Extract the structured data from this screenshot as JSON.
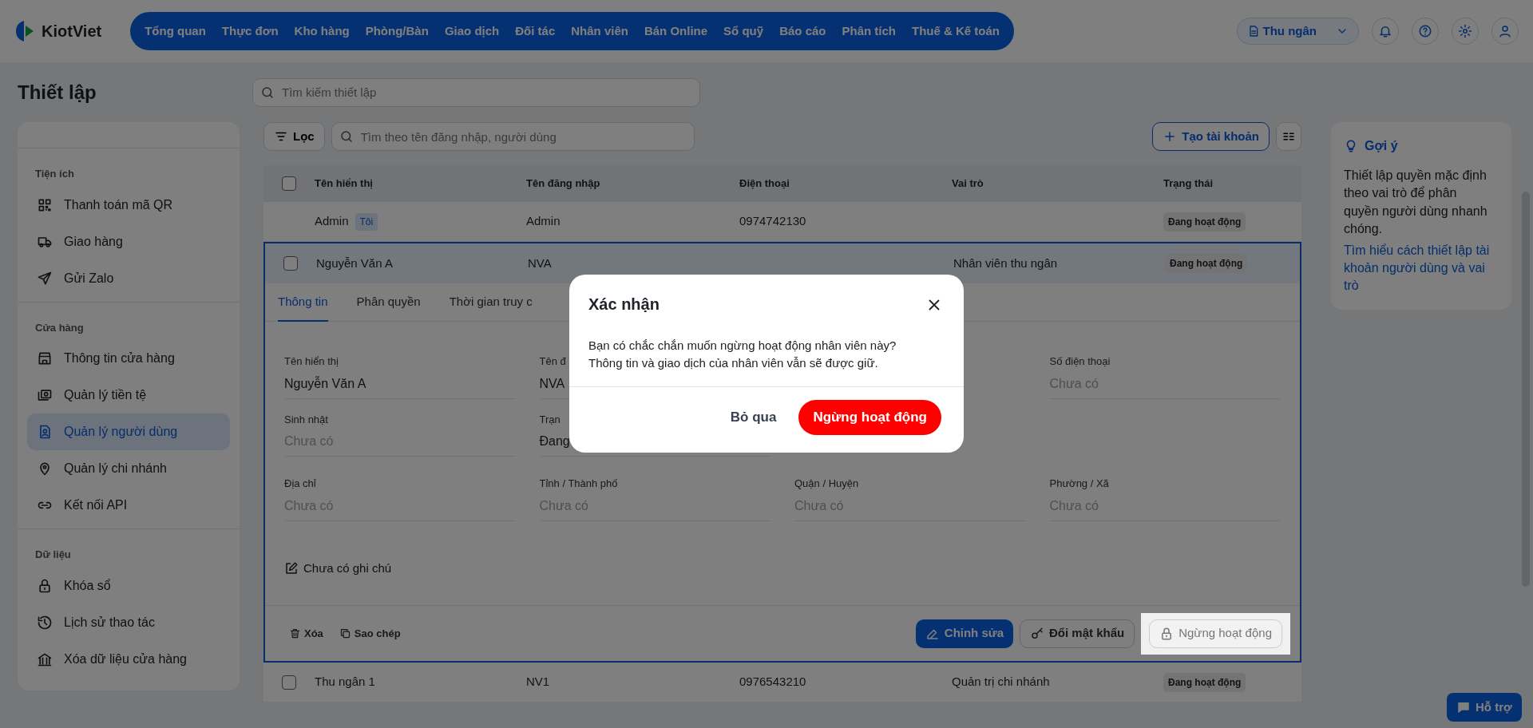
{
  "header": {
    "logo": "KiotViet",
    "nav": [
      {
        "label": "Tổng quan"
      },
      {
        "label": "Thực đơn"
      },
      {
        "label": "Kho hàng"
      },
      {
        "label": "Phòng/Bàn"
      },
      {
        "label": "Giao dịch"
      },
      {
        "label": "Đối tác"
      },
      {
        "label": "Nhân viên"
      },
      {
        "label": "Bán Online"
      },
      {
        "label": "Sổ quỹ"
      },
      {
        "label": "Báo cáo"
      },
      {
        "label": "Phân tích"
      },
      {
        "label": "Thuế & Kế toán"
      }
    ],
    "role_button": "Thu ngân"
  },
  "page": {
    "title": "Thiết lập",
    "search": {
      "placeholder": "Tìm kiếm thiết lập"
    }
  },
  "sidebar": {
    "groups": [
      {
        "title": "Tiện ích",
        "items": [
          {
            "kind": "qr",
            "label": "Thanh toán mã QR",
            "selected": false
          },
          {
            "kind": "truck",
            "label": "Giao hàng",
            "selected": false
          },
          {
            "kind": "send",
            "label": "Gửi Zalo",
            "selected": false
          }
        ]
      },
      {
        "title": "Cửa hàng",
        "items": [
          {
            "kind": "store",
            "label": "Thông tin cửa hàng",
            "selected": false
          },
          {
            "kind": "money",
            "label": "Quản lý tiền tệ",
            "selected": false
          },
          {
            "kind": "user",
            "label": "Quản lý người dùng",
            "selected": true
          },
          {
            "kind": "pin",
            "label": "Quản lý chi nhánh",
            "selected": false
          },
          {
            "kind": "link",
            "label": "Kết nối API",
            "selected": false
          }
        ]
      },
      {
        "title": "Dữ liệu",
        "items": [
          {
            "kind": "lock",
            "label": "Khóa sổ",
            "selected": false
          },
          {
            "kind": "history",
            "label": "Lịch sử thao tác",
            "selected": false
          },
          {
            "kind": "bank",
            "label": "Xóa dữ liệu cửa hàng",
            "selected": false
          }
        ]
      }
    ]
  },
  "toolbar": {
    "filter_button": "Lọc",
    "search": {
      "placeholder": "Tìm theo tên đăng nhập, người dùng"
    },
    "create_button": "Tạo tài khoản"
  },
  "table": {
    "header_checkbox": {
      "checked": false
    },
    "columns": [
      "Tên hiển thị",
      "Tên đăng nhập",
      "Điện thoại",
      "Vai trò",
      "Trạng thái"
    ],
    "rows": [
      {
        "has_checkbox": false,
        "expanded": false,
        "display_name": "Admin",
        "tag": "Tôi",
        "username": "Admin",
        "phone": "0974742130",
        "status": "Đang hoạt động"
      },
      {
        "has_checkbox": true,
        "checked": false,
        "expanded": true,
        "display_name": "Nguyễn Văn A",
        "username": "NVA",
        "role": "Nhân viên thu ngân",
        "status": "Đang hoạt động"
      },
      {
        "has_checkbox": true,
        "checked": false,
        "expanded": false,
        "display_name": "Thu ngân 1",
        "username": "NV1",
        "phone": "0976543210",
        "role": "Quản trị chi nhánh",
        "status": "Đang hoạt động"
      }
    ]
  },
  "detail": {
    "tabs": [
      {
        "label": "Thông tin",
        "selected": true
      },
      {
        "label": "Phân quyền",
        "selected": false
      },
      {
        "label": "Thời gian truy c",
        "selected": false
      }
    ],
    "field_rows": [
      [
        {
          "label": "Tên hiển thị",
          "value": "Nguyễn Văn A"
        },
        {
          "label": "Tên đ",
          "value": "NVA"
        },
        null,
        {
          "label": "Số điện thoại",
          "placeholder": "Chưa có"
        }
      ],
      [
        {
          "label": "Sinh nhật",
          "placeholder": "Chưa có"
        },
        {
          "label": "Trạn",
          "value": "Đang"
        },
        null,
        null
      ],
      [
        {
          "label": "Địa chỉ",
          "placeholder": "Chưa có"
        },
        {
          "label": "Tỉnh / Thành phố",
          "placeholder": "Chưa có"
        },
        {
          "label": "Quận / Huyện",
          "placeholder": "Chưa có"
        },
        {
          "label": "Phường / Xã",
          "placeholder": "Chưa có"
        }
      ]
    ],
    "note": "Chưa có ghi chú",
    "actions": [
      {
        "kind": "delete",
        "label": "Xóa",
        "raised": false
      },
      {
        "kind": "copy",
        "label": "Sao chép",
        "raised": false
      },
      {
        "kind": "edit",
        "label": "Chỉnh sửa",
        "raised": false
      },
      {
        "kind": "password",
        "label": "Đổi mật khẩu",
        "raised": false
      },
      {
        "kind": "deactivate",
        "label": "Ngừng hoạt động",
        "raised": true
      }
    ]
  },
  "hint": {
    "title": "Gợi ý",
    "text": "Thiết lập quyền mặc định theo vai trò để phân quyền người dùng nhanh chóng.",
    "link": "Tìm hiểu cách thiết lập tài khoản người dùng và vai trò"
  },
  "help_button": "Hỗ trợ",
  "dialog": {
    "title": "Xác nhận",
    "message_lines": [
      "Bạn có chắc chắn muốn ngừng hoạt động nhân viên này?",
      "Thông tin và giao dịch của nhân viên vẫn sẽ được giữ."
    ],
    "cancel_button": "Bỏ qua",
    "confirm_button": "Ngừng hoạt động"
  }
}
